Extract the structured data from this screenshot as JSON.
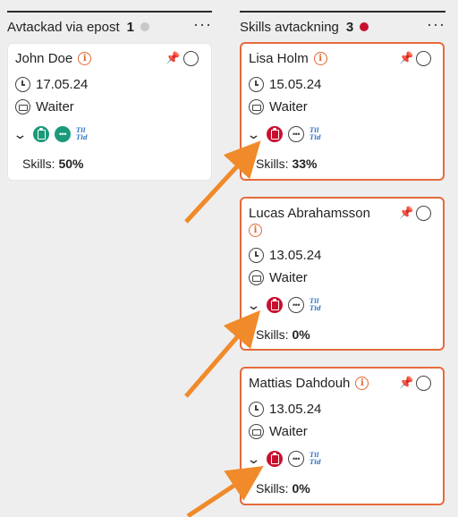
{
  "columns": [
    {
      "title": "Avtackad via epost",
      "count": "1",
      "more": "···",
      "cards": [
        {
          "name": "John Doe",
          "date": "17.05.24",
          "role": "Waiter",
          "skills_label": "Skills:",
          "skills_value": "50%",
          "tiltid": "Til Tid"
        }
      ]
    },
    {
      "title": "Skills avtackning",
      "count": "3",
      "more": "···",
      "cards": [
        {
          "name": "Lisa Holm",
          "date": "15.05.24",
          "role": "Waiter",
          "skills_label": "Skills:",
          "skills_value": "33%",
          "tiltid": "Til Tid"
        },
        {
          "name": "Lucas Abrahamsson",
          "date": "13.05.24",
          "role": "Waiter",
          "skills_label": "Skills:",
          "skills_value": "0%",
          "tiltid": "Til Tid"
        },
        {
          "name": "Mattias Dahdouh",
          "date": "13.05.24",
          "role": "Waiter",
          "skills_label": "Skills:",
          "skills_value": "0%",
          "tiltid": "Til Tid"
        }
      ]
    }
  ],
  "colors": {
    "accent": "#e66a3a",
    "danger": "#c8102e",
    "success": "#1a9a7b",
    "status_neutral": "#c8c8c8",
    "link": "#3a79c4"
  },
  "icons": [
    "info-icon",
    "pin-icon",
    "select-circle-icon",
    "clock-icon",
    "briefcase-icon",
    "chevron-down-icon",
    "clipboard-icon",
    "chat-icon",
    "tiltid-logo",
    "more-icon",
    "annotation-arrow"
  ]
}
